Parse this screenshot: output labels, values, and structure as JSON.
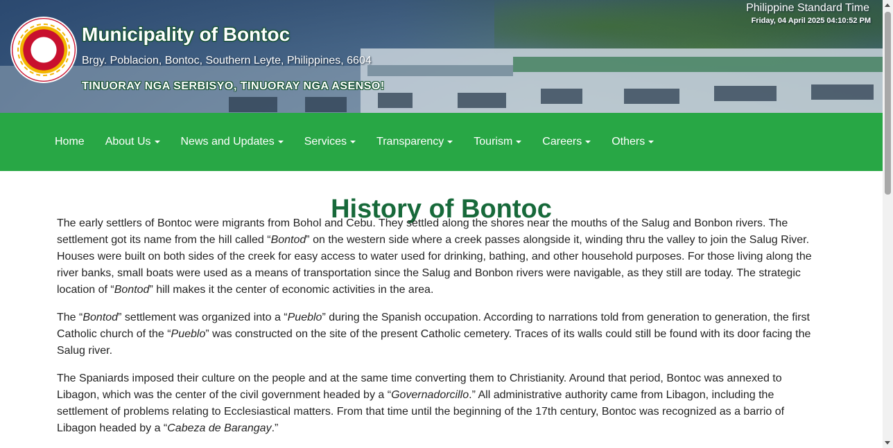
{
  "header": {
    "title": "Municipality of Bontoc",
    "address": "Brgy. Poblacion, Bontoc, Southern Leyte, Philippines, 6604",
    "motto": "TINUORAY NGA SERBISYO, TINUORAY NGA ASENSO!",
    "seal_icon": "municipal-seal",
    "clock_label": "Philippine Standard Time",
    "clock_value": "Friday, 04 April 2025 04:10:52 PM"
  },
  "nav": {
    "items": [
      {
        "label": "Home",
        "dropdown": false
      },
      {
        "label": "About Us",
        "dropdown": true
      },
      {
        "label": "News and Updates",
        "dropdown": true
      },
      {
        "label": "Services",
        "dropdown": true
      },
      {
        "label": "Transparency",
        "dropdown": true
      },
      {
        "label": "Tourism",
        "dropdown": true
      },
      {
        "label": "Careers",
        "dropdown": true
      },
      {
        "label": "Others",
        "dropdown": true
      }
    ]
  },
  "main": {
    "title": "History of Bontoc",
    "paragraphs": [
      [
        {
          "t": "The early settlers of Bontoc were migrants from Bohol and Cebu.  They settled along the shores near the mouths of the Salug and Bonbon rivers.  The settlement got its name from the hill called “"
        },
        {
          "t": "Bontod",
          "i": true
        },
        {
          "t": "” on the western side where a creek passes alongside it, winding thru the valley to join the Salug River.  Houses were built on both sides of the creek for easy access to water used for drinking, bathing, and other household purposes. For those living along the river banks, small boats were used as a means of transportation since the Salug and Bonbon rivers were navigable, as they still are today. The strategic location of “"
        },
        {
          "t": "Bontod",
          "i": true
        },
        {
          "t": "” hill makes it the center of economic activities in the area."
        }
      ],
      [
        {
          "t": "The “"
        },
        {
          "t": "Bontod",
          "i": true
        },
        {
          "t": "” settlement was organized into a “"
        },
        {
          "t": "Pueblo",
          "i": true
        },
        {
          "t": "” during the Spanish occupation. According to narrations told from generation to generation, the first Catholic church of the “"
        },
        {
          "t": "Pueblo",
          "i": true
        },
        {
          "t": "” was constructed on the site of the present Catholic cemetery. Traces of its walls could still be found with its door facing the Salug river."
        }
      ],
      [
        {
          "t": "The Spaniards imposed their culture on the people and at the same time converting them to Christianity.  Around that period, Bontoc was annexed to Libagon, which was the center of the civil government headed by a “"
        },
        {
          "t": "Governadorcillo",
          "i": true
        },
        {
          "t": ".”   All administrative authority came from Libagon, including the settlement of problems relating to Ecclesiastical matters.   From that time until the beginning of the 17th century, Bontoc was recognized as a barrio of Libagon headed by a “"
        },
        {
          "t": "Cabeza de Barangay",
          "i": true
        },
        {
          "t": ".”"
        }
      ]
    ]
  },
  "scrollbar": {
    "position_fraction": 0.0
  }
}
